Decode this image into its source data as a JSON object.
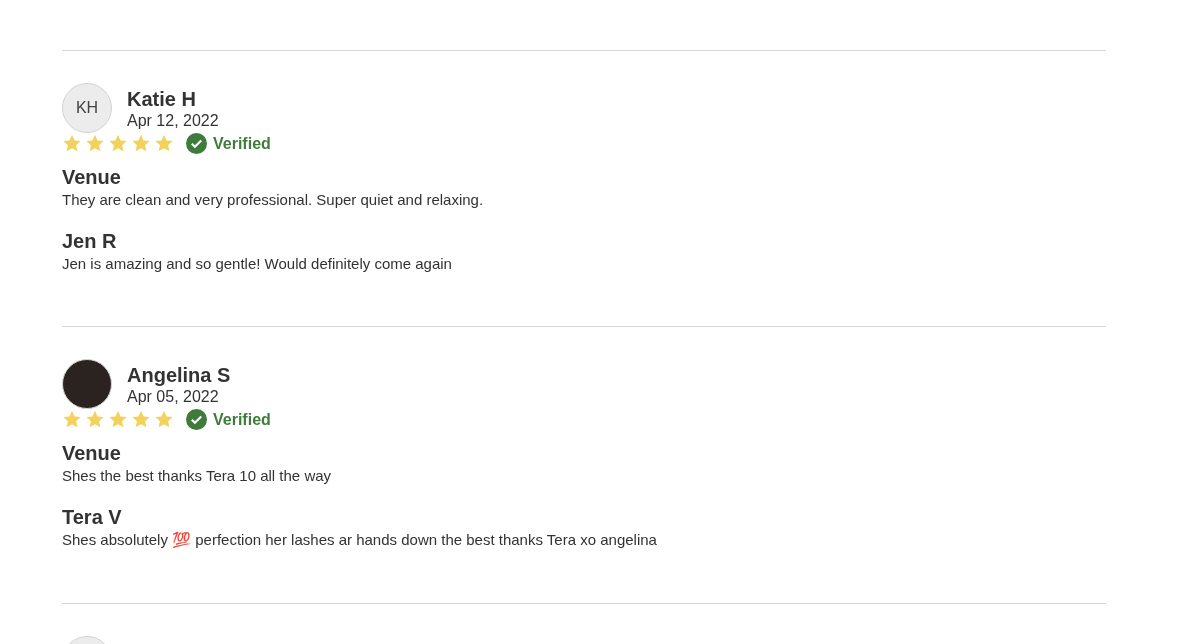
{
  "reviews": [
    {
      "name": "Katie H",
      "date": "Apr 12, 2022",
      "avatar": {
        "kind": "initials",
        "initials": "KH"
      },
      "stars": 5,
      "verified": true,
      "verified_label": "Verified",
      "sections": [
        {
          "title": "Venue",
          "text": "They are clean and very professional. Super quiet and relaxing."
        },
        {
          "title": "Jen R",
          "text": "Jen is amazing and so gentle! Would definitely come again"
        }
      ]
    },
    {
      "name": "Angelina S",
      "date": "Apr 05, 2022",
      "avatar": {
        "kind": "photo"
      },
      "stars": 5,
      "verified": true,
      "verified_label": "Verified",
      "sections": [
        {
          "title": "Venue",
          "text": "Shes the best thanks Tera 10 all the way"
        },
        {
          "title": "Tera V",
          "text": "Shes absolutely 💯 perfection her lashes ar hands down the best thanks Tera xo angelina"
        }
      ]
    }
  ]
}
